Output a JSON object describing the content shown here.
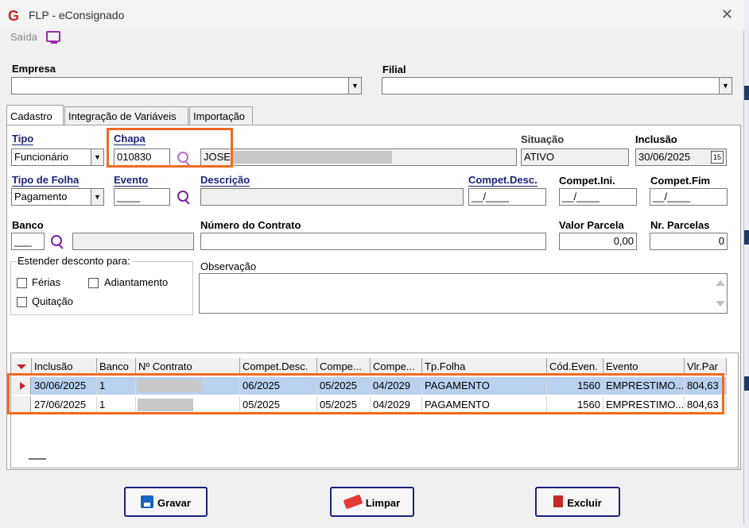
{
  "window": {
    "title": "FLP - eConsignado",
    "logo": "G",
    "close_icon": "close-icon"
  },
  "menu": {
    "saida_label": "Saída"
  },
  "labels": {
    "empresa": "Empresa",
    "filial": "Filial",
    "tipo": "Tipo",
    "chapa": "Chapa",
    "situacao": "Situação",
    "inclusao": "Inclusão",
    "tipo_folha": "Tipo de Folha",
    "evento": "Evento",
    "descricao": "Descrição",
    "compet_desc": "Compet.Desc.",
    "compet_ini": "Compet.Ini.",
    "compet_fim": "Compet.Fim",
    "banco": "Banco",
    "numero_contrato": "Número do Contrato",
    "valor_parcela": "Valor Parcela",
    "nr_parcelas": "Nr. Parcelas",
    "estender": "Estender desconto para:",
    "ferias": "Férias",
    "adiantamento": "Adiantamento",
    "quitacao": "Quitação",
    "observacao": "Observação"
  },
  "tabs": [
    {
      "label": "Cadastro",
      "active": true
    },
    {
      "label": "Integração de Variáveis",
      "active": false
    },
    {
      "label": "Importação",
      "active": false
    }
  ],
  "fields": {
    "empresa": "",
    "filial": "",
    "tipo": "Funcionário",
    "chapa": "010830",
    "nome": "JOSE",
    "situacao": "ATIVO",
    "inclusao": "30/06/2025",
    "calendar_label": "15",
    "tipo_folha": "Pagamento",
    "evento": "____",
    "descricao": "",
    "compet_desc": "__/____",
    "compet_ini": "__/____",
    "compet_fim": "__/____",
    "banco": "___",
    "banco_nome": "",
    "numero_contrato": "",
    "valor_parcela": "0,00",
    "nr_parcelas": "0",
    "observacao": ""
  },
  "grid": {
    "columns": [
      "Inclusão",
      "Banco",
      "Nº Contrato",
      "Compet.Desc.",
      "Compe...",
      "Compe...",
      "Tp.Folha",
      "Cód.Even.",
      "Evento",
      "Vlr.Par"
    ],
    "rows": [
      [
        "30/06/2025",
        "1",
        "",
        "06/2025",
        "05/2025",
        "04/2029",
        "PAGAMENTO",
        "1560",
        "EMPRESTIMO...",
        "804,63"
      ],
      [
        "27/06/2025",
        "1",
        "",
        "05/2025",
        "05/2025",
        "04/2029",
        "PAGAMENTO",
        "1560",
        "EMPRESTIMO...",
        "804,63"
      ]
    ]
  },
  "buttons": {
    "gravar": "Gravar",
    "limpar": "Limpar",
    "excluir": "Excluir"
  },
  "colors": {
    "highlight": "#f26a21",
    "label_blue": "#1a237e",
    "selected_row": "#b9d1ee"
  }
}
